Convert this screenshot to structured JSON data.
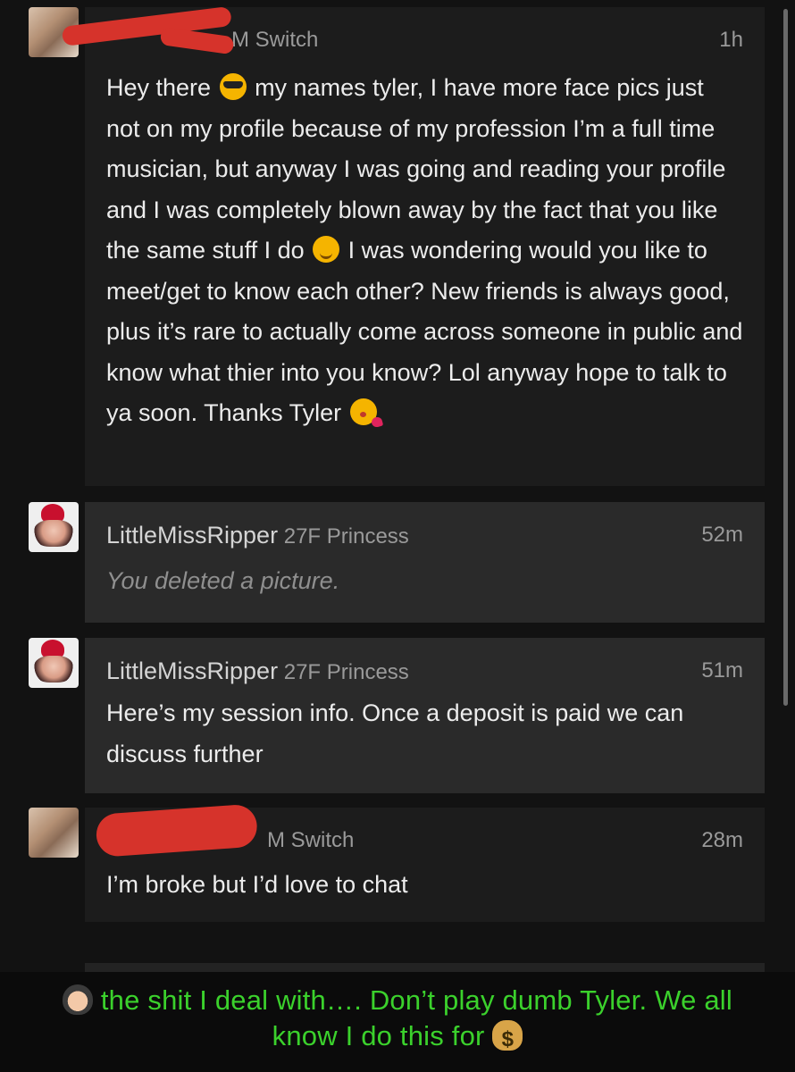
{
  "messages": [
    {
      "sender": "",
      "meta": "M Switch",
      "time": "1h",
      "body_parts": [
        "Hey there ",
        " my names tyler, I have more face pics just not on my profile because of my profession I’m a full time musician, but anyway I was going and reading your profile and I was completely blown away by the fact that you like the same stuff I do ",
        " I was wondering would you like to meet/get to know each other? New friends is always good, plus it’s rare to actually come across someone in public and know what thier into you know? Lol anyway hope to talk to ya soon. Thanks Tyler "
      ],
      "emojis": [
        "sunglasses-emoji",
        "smiling-emoji",
        "kiss-emoji"
      ]
    },
    {
      "sender": "LittleMissRipper",
      "meta": "27F Princess",
      "time": "52m",
      "body": "You deleted a picture."
    },
    {
      "sender": "LittleMissRipper",
      "meta": "27F Princess",
      "time": "51m",
      "body": "Here’s my session info. Once a deposit is paid we can discuss further"
    },
    {
      "sender": "",
      "meta": "M Switch",
      "time": "28m",
      "body": "I’m broke but I’d love to chat"
    }
  ],
  "caption": {
    "text_part1": "the shit I deal with…. Don’t play dumb Tyler. We all know I do this for ",
    "emoji_start": "facepalm-woman-emoji",
    "emoji_end": "money-bag-emoji",
    "color": "#3bd12c"
  },
  "colors": {
    "background": "#121212",
    "bubble_own": "#1c1c1c",
    "bubble_theirs": "#2a2a2a",
    "redaction": "#d6332b"
  }
}
